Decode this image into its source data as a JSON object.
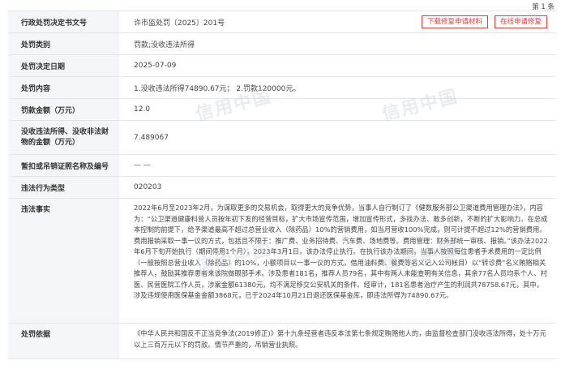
{
  "page_indicator": "第 1 条",
  "rows": {
    "decision_no": {
      "label": "行政处罚决定书文号",
      "value": "许市监处罚〔2025〕201号"
    },
    "category": {
      "label": "处罚类别",
      "value": "罚款;没收违法所得"
    },
    "date": {
      "label": "处罚决定日期",
      "value": "2025-07-09"
    },
    "content": {
      "label": "处罚内容",
      "value": "1.没收违法所得74890.67元； 2.罚款120000元。"
    },
    "fine": {
      "label": "罚款金额（万元）",
      "value": "12.0"
    },
    "confiscated": {
      "label": "没收违法所得、没收非法财物的金额（万元）",
      "value": "7.489067"
    },
    "license": {
      "label": "暂扣或吊销证照名称及编号",
      "value": "— —"
    },
    "violation_type": {
      "label": "违法行为类型",
      "value": "020203"
    },
    "facts": {
      "label": "违法事实",
      "value": "2022年6月至2023年2月，为谋取更多的交易机会，取得更大的竞争优势，当事人自行制订了《健数服务部公卫渠道费用管理办法》，内容为：“公卫渠道健康科营人员按年初下发的经营目标，扩大市场宣传范围，增加宣传形式，多找办法、敢多创新，不断的扩大影响力。在总成本控制的前提下，给予渠道最高不超过总营业收入（除药品）10%的营销费用，如当月营收100%完成，则可计提不超过12%的营销费用。费用报销采取一事一议的方式，包括且不限于：推广费、业务招待费、汽车费、场地费等。费用管理：财务部统一审核、报销。”该办法2022年6月下旬开始执行（期间停用1个月），2023年3月1日，该办法停止执行。在执行该办法期间，当事人按照每位患者手术费用的一定比例（一般按照总营业收入（除药品）的10%，小额项目以一事一议的方式，借用油料费、餐费等名义记入公司帐目）以“转诊费”名义贿赂相关推荐人，鼓励其推荐患者来该院做眼部手术。涉及患者181名，推荐人员79名，其中有两人未能查明有关信息，其余77名人员均系个人、村医、民营医院工作人员，涉案金额61380元，均不满足移交公安机关的条件。经审计，181名患者治疗产生的利润共78758.67元，其中，涉及违规使用医保基金金额3868元，已于2024年10月21日退还医保基金库，即违法所得为74890.67元。"
    },
    "basis": {
      "label": "处罚依据",
      "value": "《中华人民共和国反不正当竞争法(2019修正)》第十九条经营者违反本法第七条规定贿赂他人的，由监督检查部门没收违法所得，处十万元以上三百万元以下的罚款。情节严重的，吊销营业执照。"
    }
  },
  "buttons": {
    "download": "下载修复申请材料",
    "apply": "在线申请修复"
  },
  "watermark": "信用中国"
}
